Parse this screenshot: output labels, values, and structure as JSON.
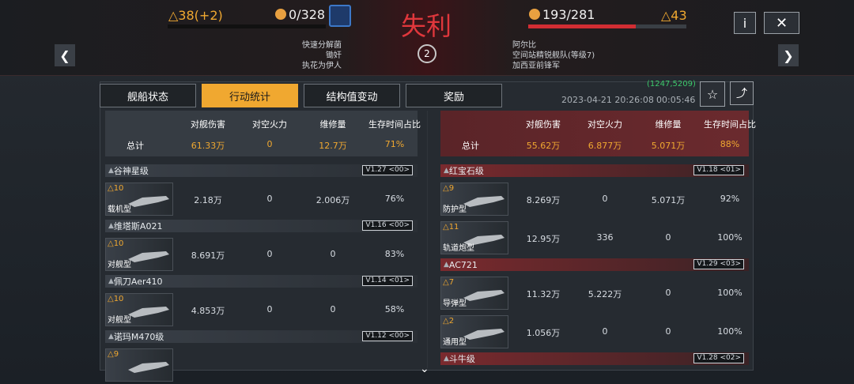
{
  "header": {
    "left_level": "△38(+2)",
    "left_score": "0/328",
    "result": "失利",
    "right_score": "193/281",
    "right_level": "△43",
    "left_tags": [
      "快速分解菌",
      "锄奸",
      "执花为伊人"
    ],
    "right_tags": [
      "阿尔比",
      "空间站精锐舰队(等级7)",
      "加西亚前锋军"
    ],
    "center_count": "2",
    "info_label": "i",
    "close_label": "✕",
    "prev_label": "❮",
    "next_label": "❯"
  },
  "tabs": [
    "舰船状态",
    "行动统计",
    "结构值变动",
    "奖励"
  ],
  "meta": {
    "id": "(1247,5209)",
    "datetime": "2023-04-21 20:26:08",
    "duration": "00:05:46"
  },
  "columns": [
    "对舰伤害",
    "对空火力",
    "维修量",
    "生存时间占比"
  ],
  "left": {
    "total_label": "总计",
    "total": [
      "61.33万",
      "0",
      "12.7万",
      "71%"
    ],
    "groups": [
      {
        "name": "谷神星级",
        "ver": "V1.27 <00>",
        "ships": [
          {
            "lvl": "△10",
            "type": "载机型",
            "vals": [
              "2.18万",
              "0",
              "2.006万",
              "76%"
            ]
          }
        ]
      },
      {
        "name": "维塔斯A021",
        "ver": "V1.16 <00>",
        "ships": [
          {
            "lvl": "△10",
            "type": "对舰型",
            "vals": [
              "8.691万",
              "0",
              "0",
              "83%"
            ]
          }
        ]
      },
      {
        "name": "佩刀Aer410",
        "ver": "V1.14 <01>",
        "ships": [
          {
            "lvl": "△10",
            "type": "对舰型",
            "vals": [
              "4.853万",
              "0",
              "0",
              "58%"
            ]
          }
        ]
      },
      {
        "name": "诺玛M470级",
        "ver": "V1.12 <00>",
        "ships": [
          {
            "lvl": "△9",
            "type": "",
            "vals": [
              "",
              "",
              "",
              ""
            ]
          }
        ]
      }
    ]
  },
  "right": {
    "total_label": "总计",
    "total": [
      "55.62万",
      "6.877万",
      "5.071万",
      "88%"
    ],
    "groups": [
      {
        "name": "红宝石级",
        "ver": "V1.18 <01>",
        "ships": [
          {
            "lvl": "△9",
            "type": "防护型",
            "vals": [
              "8.269万",
              "0",
              "5.071万",
              "92%"
            ]
          },
          {
            "lvl": "△11",
            "type": "轨道炮型",
            "vals": [
              "12.95万",
              "336",
              "0",
              "100%"
            ]
          }
        ]
      },
      {
        "name": "AC721",
        "ver": "V1.29 <03>",
        "ships": [
          {
            "lvl": "△7",
            "type": "导弹型",
            "vals": [
              "11.32万",
              "5.222万",
              "0",
              "100%"
            ]
          },
          {
            "lvl": "△2",
            "type": "通用型",
            "vals": [
              "1.056万",
              "0",
              "0",
              "100%"
            ]
          }
        ]
      },
      {
        "name": "斗牛级",
        "ver": "V1.28 <02>",
        "ships": []
      }
    ]
  },
  "colors": {
    "accent": "#f0a830",
    "enemy": "#d12d33"
  }
}
